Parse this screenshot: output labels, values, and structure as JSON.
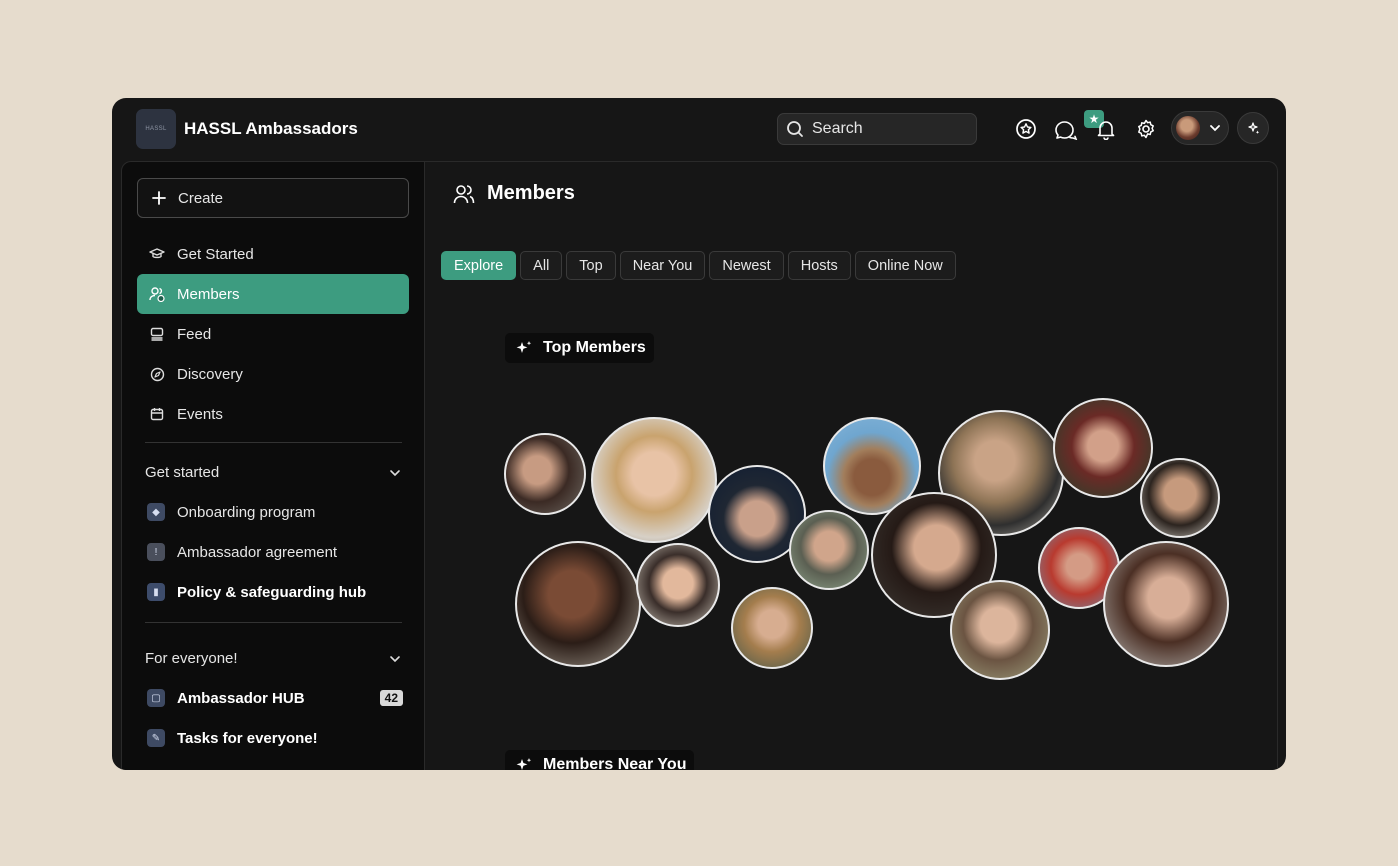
{
  "app": {
    "title": "HASSL Ambassadors",
    "logo_text": "HASSL"
  },
  "search": {
    "placeholder": "Search"
  },
  "topbar": {
    "icons": [
      "star-circle-icon",
      "chat-bubbles-icon",
      "bell-icon",
      "gear-icon",
      "chevron-down-icon",
      "sparkle-icon"
    ],
    "badge_glyph": "★"
  },
  "sidebar": {
    "create_label": "Create",
    "nav": [
      {
        "label": "Get Started",
        "icon": "graduation-cap-icon"
      },
      {
        "label": "Members",
        "icon": "users-icon",
        "active": true
      },
      {
        "label": "Feed",
        "icon": "feed-icon"
      },
      {
        "label": "Discovery",
        "icon": "compass-icon"
      },
      {
        "label": "Events",
        "icon": "calendar-icon"
      }
    ],
    "groups": [
      {
        "title": "Get started",
        "items": [
          {
            "label": "Onboarding program",
            "bold": false
          },
          {
            "label": "Ambassador agreement",
            "bold": false
          },
          {
            "label": "Policy & safeguarding hub",
            "bold": true
          }
        ]
      },
      {
        "title": "For everyone!",
        "items": [
          {
            "label": "Ambassador HUB",
            "bold": true,
            "count": "42"
          },
          {
            "label": "Tasks for everyone!",
            "bold": true
          }
        ]
      }
    ]
  },
  "main": {
    "title": "Members",
    "tabs": [
      "Explore",
      "All",
      "Top",
      "Near You",
      "Newest",
      "Hosts",
      "Online Now"
    ],
    "active_tab": "Explore",
    "sections": [
      "Top Members",
      "Members Near You"
    ]
  },
  "colors": {
    "accent": "#3d9c80",
    "background": "#161616",
    "sidebar": "#0c0c0c",
    "page": "#e6dccd"
  }
}
